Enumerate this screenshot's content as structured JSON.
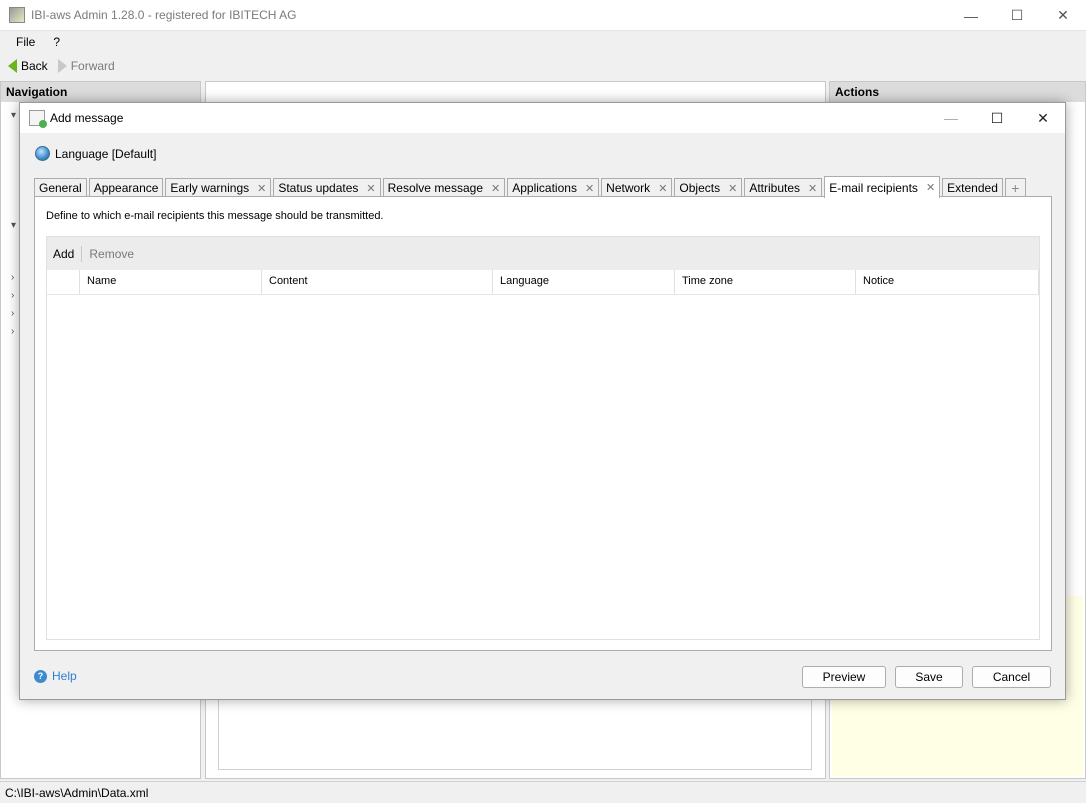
{
  "main_window": {
    "title": "IBI-aws Admin 1.28.0 - registered for IBITECH AG",
    "menu": [
      "File",
      "?"
    ],
    "back_label": "Back",
    "forward_label": "Forward",
    "navigation_header": "Navigation",
    "actions_header": "Actions",
    "status_path": "C:\\IBI-aws\\Admin\\Data.xml"
  },
  "dialog": {
    "title": "Add message",
    "language_label": "Language [Default]",
    "tabs": [
      {
        "label": "General",
        "closable": false
      },
      {
        "label": "Appearance",
        "closable": false
      },
      {
        "label": "Early warnings",
        "closable": true
      },
      {
        "label": "Status updates",
        "closable": true
      },
      {
        "label": "Resolve message",
        "closable": true
      },
      {
        "label": "Applications",
        "closable": true
      },
      {
        "label": "Network",
        "closable": true
      },
      {
        "label": "Objects",
        "closable": true
      },
      {
        "label": "Attributes",
        "closable": true
      },
      {
        "label": "E-mail recipients",
        "closable": true,
        "active": true
      },
      {
        "label": "Extended",
        "closable": false
      }
    ],
    "add_tab_symbol": "+",
    "description": "Define to which e-mail recipients this message should be transmitted.",
    "grid": {
      "add_label": "Add",
      "remove_label": "Remove",
      "columns": [
        "Name",
        "Content",
        "Language",
        "Time zone",
        "Notice"
      ]
    },
    "help_label": "Help",
    "buttons": {
      "preview": "Preview",
      "save": "Save",
      "cancel": "Cancel"
    }
  },
  "colors": {
    "link": "#2f7fd0",
    "back_arrow": "#6cb320",
    "pane_header": "#dcdcdc",
    "actions_panel_bg": "#ffffe6"
  }
}
